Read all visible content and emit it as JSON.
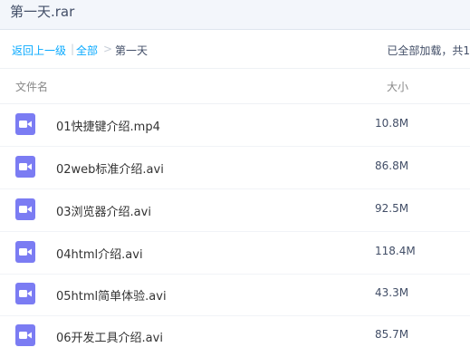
{
  "window": {
    "title": "第一天.rar"
  },
  "breadcrumb": {
    "back": "返回上一级",
    "sep1": "|",
    "all": "全部",
    "sep2": ">",
    "current": "第一天"
  },
  "status": "已全部加载，共1",
  "table": {
    "headers": {
      "name": "文件名",
      "size": "大小"
    },
    "rows": [
      {
        "name": "01快捷键介绍.mp4",
        "size": "10.8M",
        "icon": "video-file-icon"
      },
      {
        "name": "02web标准介绍.avi",
        "size": "86.8M",
        "icon": "video-file-icon"
      },
      {
        "name": "03浏览器介绍.avi",
        "size": "92.5M",
        "icon": "video-file-icon"
      },
      {
        "name": "04html介绍.avi",
        "size": "118.4M",
        "icon": "video-file-icon"
      },
      {
        "name": "05html简单体验.avi",
        "size": "43.3M",
        "icon": "video-file-icon"
      },
      {
        "name": "06开发工具介绍.avi",
        "size": "85.7M",
        "icon": "video-file-icon"
      }
    ]
  },
  "colors": {
    "link": "#09aaff",
    "file_icon": "#7b7cf3",
    "title_bar_bg": "#f3f6fb"
  }
}
